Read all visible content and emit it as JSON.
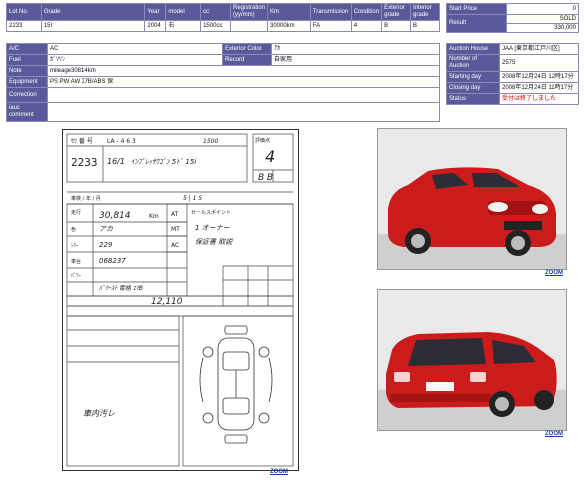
{
  "lot_table": {
    "headers": [
      "Lot No.",
      "Grade",
      "Year",
      "model",
      "cc",
      "Registration (yy/mm)",
      "Km",
      "Transmission",
      "Condition",
      "Exterior grade",
      "Interior grade"
    ],
    "values": [
      "2233",
      "15I",
      "2004",
      "右",
      "1500cc",
      "",
      "30000km",
      "FA",
      "4",
      "B",
      "B"
    ]
  },
  "price_table": {
    "start_label": "Start Price",
    "start_value": "0",
    "result_label": "Result",
    "result_status": "SOLD",
    "result_value": "330,000"
  },
  "details": {
    "ac_label": "A/C",
    "ac_value": "AC",
    "ext_color_label": "Exterior Color",
    "ext_color_value": "ｱｶ",
    "fuel_label": "Fuel",
    "fuel_value": "ｶﾞｿﾘﾝ",
    "record_label": "Record",
    "record_value": "自家用",
    "note_label": "Note",
    "note_value": "mileage30814km",
    "equipment_label": "Equipment",
    "equipment_value": "PS PW AW ｴｱB/ABS 保",
    "correction_label": "Correction",
    "correction_value": "",
    "iauc_label": "iauc comment",
    "iauc_value": ""
  },
  "auction": {
    "house_label": "Auction House",
    "house_value": "JAA [東京都江戸川区]",
    "number_label": "Number of Auction",
    "number_value": "2575",
    "start_label": "Starting day",
    "start_value": "2008年12月24日 12時17分",
    "closing_label": "Closing day",
    "closing_value": "2008年12月24日 11時17分",
    "status_label": "Status",
    "status_value": "受付は終了しました"
  },
  "sheet": {
    "lot": "2233",
    "year": "16/1",
    "model": "ｲﾝﾌﾟﾚｯｻﾜｺﾞﾝ 5ﾄﾞ 15i",
    "cc": "1500",
    "grade_score": "4",
    "int_ext": "B B",
    "mileage": "30,814",
    "mileage_unit": "Km",
    "color": "アカ",
    "trans": "AT",
    "trans2": "MT",
    "ac": "AC",
    "chassis_no": "229",
    "serial": "068237",
    "features": "ﾊﾟﾜｰｽﾃ 電格 ｴｱB",
    "price_note": "12,110",
    "selling_points": "セールスポイント",
    "sp_line1": "1 オーナー",
    "sp_line2": "保証書 取説",
    "handwritten": "車内汚レ",
    "grade_header": "評価点",
    "zoom_label": "ZOOM"
  },
  "photos": {
    "front_zoom": "ZOOM",
    "rear_zoom": "ZOOM"
  },
  "colors": {
    "header_bg": "#5a5a9a",
    "border": "#8a8ab8",
    "car": "#cc1b1b",
    "status": "#d00000",
    "link": "#1a3ea8"
  }
}
